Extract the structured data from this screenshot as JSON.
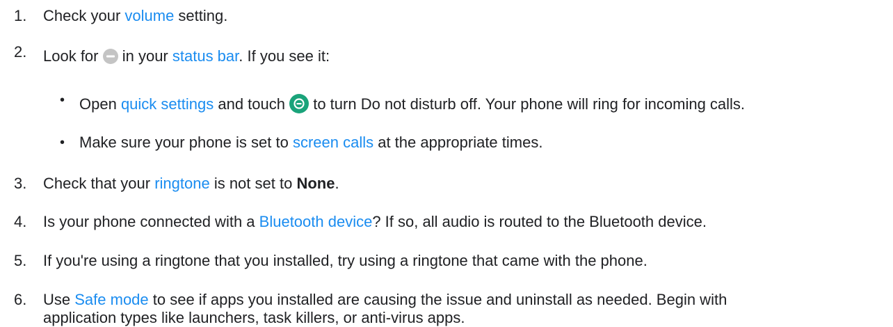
{
  "steps": [
    {
      "number": "1.",
      "pre": "Check your ",
      "link": "volume",
      "post": " setting."
    },
    {
      "number": "2.",
      "pre": "Look for ",
      "icon": "dnd-status-icon",
      "mid": " in your ",
      "link": "status bar",
      "post": ". If you see it:",
      "bullets": [
        {
          "pre": "Open ",
          "link": "quick settings",
          "mid": " and touch ",
          "icon": "dnd-toggle-icon",
          "post": " to turn Do not disturb off. Your phone will ring for incoming calls."
        },
        {
          "pre": "Make sure your phone is set to ",
          "link": "screen calls",
          "post": " at the appropriate times."
        }
      ]
    },
    {
      "number": "3.",
      "pre": "Check that your ",
      "link": "ringtone",
      "mid": " is not set to ",
      "bold": "None",
      "post": "."
    },
    {
      "number": "4.",
      "pre": "Is your phone connected with a ",
      "link": "Bluetooth device",
      "post": "? If so, all audio is routed to the Bluetooth device."
    },
    {
      "number": "5.",
      "text": "If you're using a ringtone that you installed, try using a ringtone that came with the phone."
    },
    {
      "number": "6.",
      "pre": "Use ",
      "link": "Safe mode",
      "post": " to see if apps you installed are causing the issue and uninstall as needed. Begin with",
      "line2": "application types like launchers, task killers, or anti-virus apps."
    }
  ],
  "colors": {
    "text": "#202124",
    "link": "#1a8cf0",
    "dnd_status_icon": "#c4c4c4",
    "dnd_toggle_icon": "#1aa37a"
  }
}
